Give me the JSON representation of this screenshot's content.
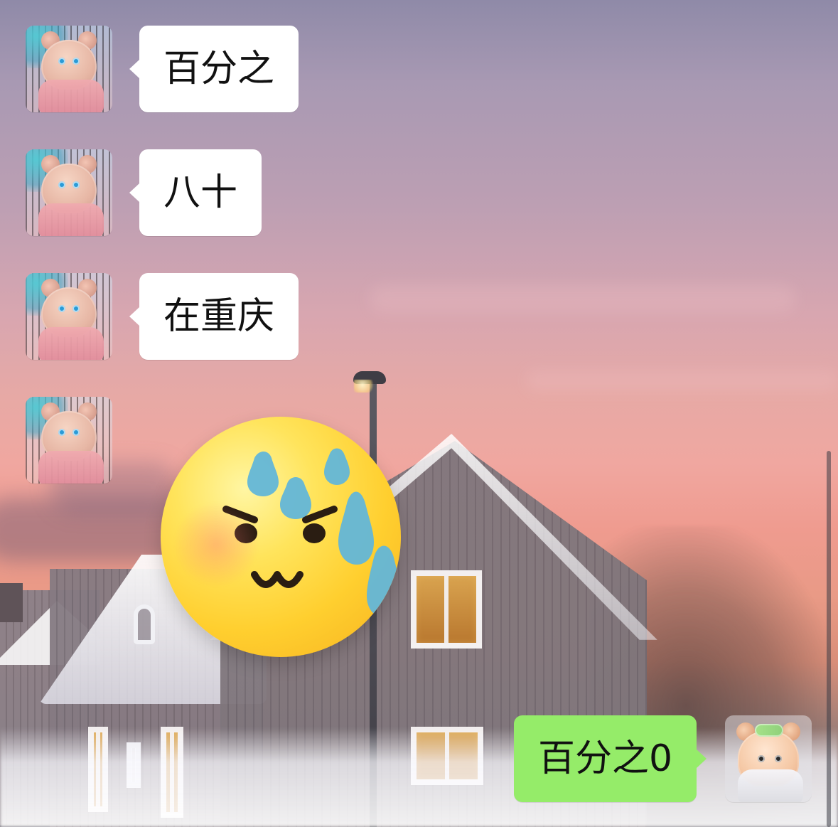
{
  "chat": {
    "messages": [
      {
        "side": "in",
        "type": "text",
        "text": "百分之"
      },
      {
        "side": "in",
        "type": "text",
        "text": "八十"
      },
      {
        "side": "in",
        "type": "text",
        "text": "在重庆"
      },
      {
        "side": "in",
        "type": "sticker",
        "sticker_icon": "sweat-angry-emoji-icon"
      },
      {
        "side": "out",
        "type": "text",
        "text": "百分之0"
      }
    ]
  },
  "icons": {
    "sticker": "sweat-angry-emoji-icon"
  },
  "colors": {
    "incoming_bubble": "#ffffff",
    "outgoing_bubble": "#95ec69",
    "text": "#111111"
  }
}
